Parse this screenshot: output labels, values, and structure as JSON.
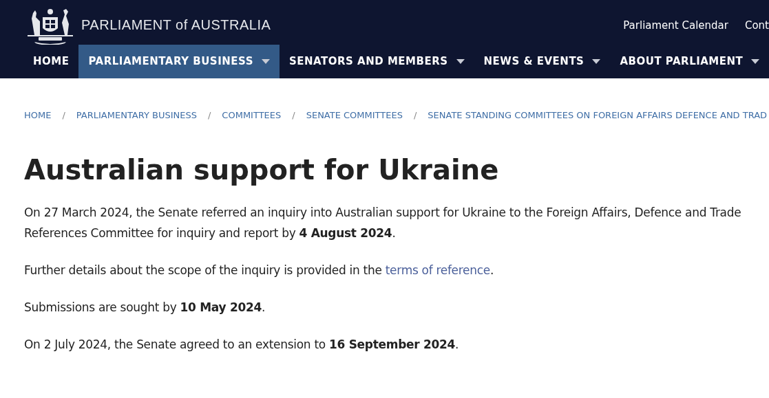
{
  "header": {
    "site_title": "PARLIAMENT of AUSTRALIA",
    "utility_links": [
      "Parliament Calendar",
      "Cont"
    ]
  },
  "nav": [
    {
      "label": "HOME",
      "selected": false,
      "dropdown": false
    },
    {
      "label": "PARLIAMENTARY BUSINESS",
      "selected": true,
      "dropdown": true
    },
    {
      "label": "SENATORS AND MEMBERS",
      "selected": false,
      "dropdown": true
    },
    {
      "label": "NEWS & EVENTS",
      "selected": false,
      "dropdown": true
    },
    {
      "label": "ABOUT PARLIAMENT",
      "selected": false,
      "dropdown": true
    }
  ],
  "breadcrumbs": [
    {
      "label": "HOME"
    },
    {
      "separator": "/",
      "label": "PARLIAMENTARY BUSINESS"
    },
    {
      "separator": "/",
      "label": "COMMITTEES"
    },
    {
      "separator": "/",
      "label": "SENATE COMMITTEES"
    },
    {
      "separator": "/",
      "label": "SENATE STANDING COMMITTEES ON FOREIGN AFFAIRS DEFENCE AND TRAD"
    }
  ],
  "page_title": "Australian support for Ukraine",
  "paragraphs": [
    [
      {
        "kind": "text",
        "text": "On 27 March 2024, the Senate referred an inquiry into Australian support for Ukraine to the Foreign Affairs, Defence and Trade References Committee for inquiry and report by **4 August 2024**."
      }
    ],
    [
      {
        "kind": "text",
        "text": "Further details about the scope of the inquiry is provided in the "
      },
      {
        "kind": "link",
        "text": "terms of reference"
      },
      {
        "kind": "text",
        "text": "."
      }
    ],
    [
      {
        "kind": "text",
        "text": "Submissions are sought by **10 May 2024**."
      }
    ],
    [
      {
        "kind": "text",
        "text": "On 2 July 2024, the Senate agreed to an extension to **16 September 2024**."
      }
    ]
  ]
}
